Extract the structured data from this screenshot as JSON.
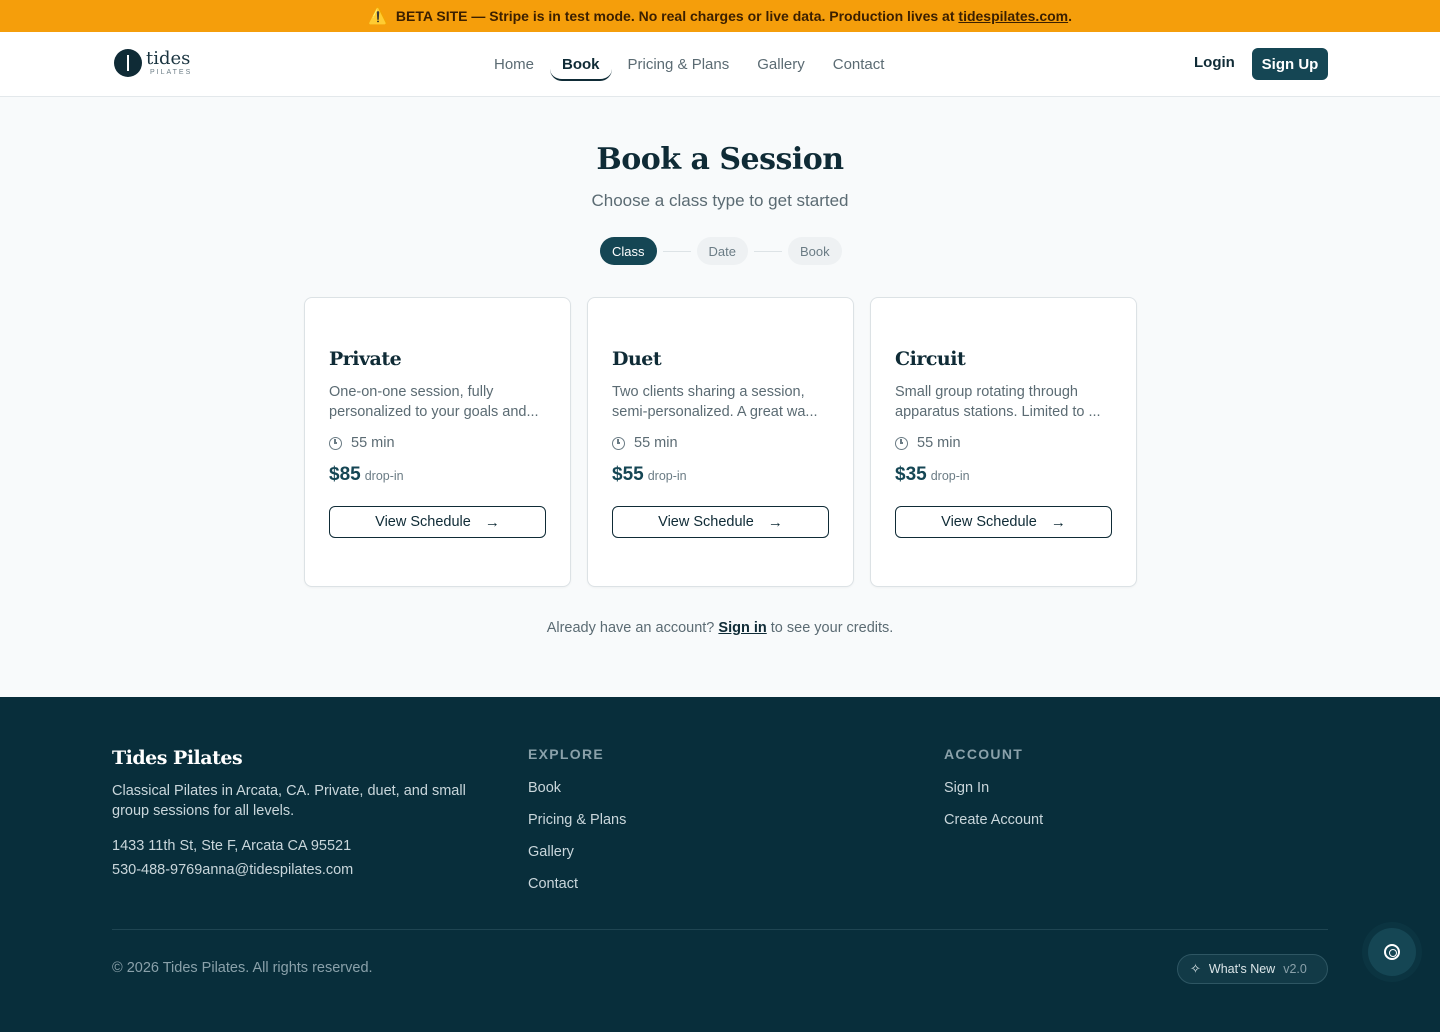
{
  "beta_banner": {
    "icon": "warning-icon",
    "text": "BETA SITE — Stripe is in test mode. No real charges or live data. Production lives at",
    "link": "tidespilates.com",
    "suffix": "."
  },
  "brand": {
    "wordmark": "tides",
    "sub": "PILATES"
  },
  "nav": {
    "links": [
      {
        "label": "Home"
      },
      {
        "label": "Book",
        "active": true
      },
      {
        "label": "Pricing & Plans"
      },
      {
        "label": "Gallery"
      },
      {
        "label": "Contact"
      }
    ],
    "login": "Login",
    "signup": "Sign Up"
  },
  "page": {
    "title": "Book a Session",
    "subtitle": "Choose a class type to get started",
    "steps": [
      "Class",
      "Date",
      "Book"
    ]
  },
  "classes": [
    {
      "name": "Private",
      "description": "One-on-one session, fully personalized to your goals and...",
      "duration": "55 min",
      "price": "$85",
      "price_unit": "drop-in",
      "button": "View Schedule"
    },
    {
      "name": "Duet",
      "description": "Two clients sharing a session, semi-personalized. A great wa...",
      "duration": "55 min",
      "price": "$55",
      "price_unit": "drop-in",
      "button": "View Schedule"
    },
    {
      "name": "Circuit",
      "description": "Small group rotating through apparatus stations. Limited to ...",
      "duration": "55 min",
      "price": "$35",
      "price_unit": "drop-in",
      "button": "View Schedule"
    }
  ],
  "account_note": {
    "prefix": "Already have an account?",
    "link": "Sign in",
    "suffix": "to see your credits."
  },
  "footer": {
    "brand": "Tides Pilates",
    "description": "Classical Pilates in Arcata, CA. Private, duet, and small group sessions for all levels.",
    "address": "1433 11th St, Ste F, Arcata CA 95521",
    "contact": "530-488-9769anna@tidespilates.com",
    "explore": {
      "heading": "EXPLORE",
      "links": [
        "Book",
        "Pricing & Plans",
        "Gallery",
        "Contact"
      ]
    },
    "account": {
      "heading": "ACCOUNT",
      "links": [
        "Sign In",
        "Create Account"
      ]
    },
    "copyright": "© 2026 Tides Pilates. All rights reserved.",
    "whats_new": {
      "label": "What's New",
      "version": "v2.0"
    }
  },
  "colors": {
    "banner": "#f59e0b",
    "primary": "#154654",
    "footer_bg": "#082e3b"
  }
}
